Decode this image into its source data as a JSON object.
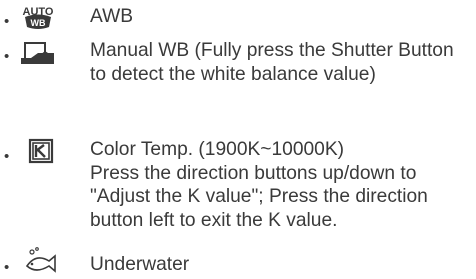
{
  "items": [
    {
      "icon": "awb-icon",
      "text": "AWB"
    },
    {
      "icon": "manual-wb-icon",
      "text": "Manual WB (Fully press the Shutter Button to detect the white balance value)"
    },
    {
      "icon": "color-temp-k-icon",
      "text": "Color Temp. (1900K~10000K)\nPress the direction buttons up/down to \"Adjust the K value\"; Press the direction button left to exit the K value."
    },
    {
      "icon": "underwater-fish-icon",
      "text": "Underwater"
    }
  ]
}
